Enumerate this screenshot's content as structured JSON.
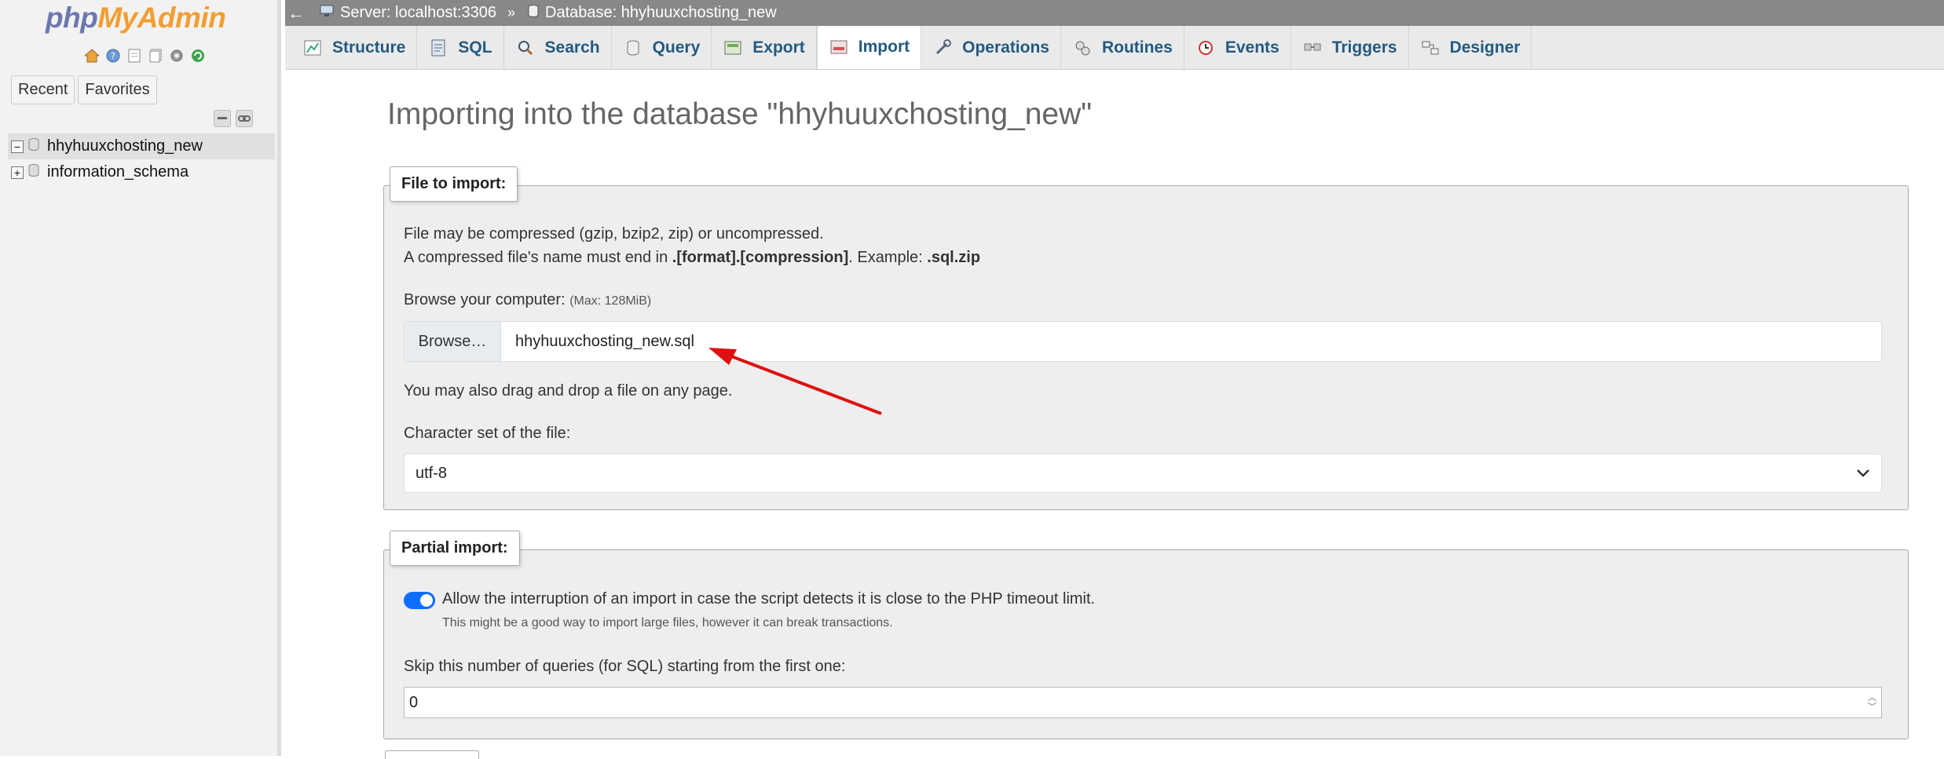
{
  "sidebar": {
    "logo_php": "php",
    "logo_myadmin": "MyAdmin",
    "tabs": {
      "recent": "Recent",
      "favorites": "Favorites"
    },
    "databases": [
      {
        "name": "hhyhuuxchosting_new",
        "expander": "−"
      },
      {
        "name": "information_schema",
        "expander": "+"
      }
    ]
  },
  "breadcrumb": {
    "back": "←",
    "server": "Server: localhost:3306",
    "separator": "»",
    "database": "Database: hhyhuuxchosting_new"
  },
  "tabs": [
    {
      "label": "Structure",
      "icon": "structure-icon"
    },
    {
      "label": "SQL",
      "icon": "sql-icon"
    },
    {
      "label": "Search",
      "icon": "search-icon"
    },
    {
      "label": "Query",
      "icon": "query-icon"
    },
    {
      "label": "Export",
      "icon": "export-icon"
    },
    {
      "label": "Import",
      "icon": "import-icon",
      "active": true
    },
    {
      "label": "Operations",
      "icon": "operations-icon"
    },
    {
      "label": "Routines",
      "icon": "routines-icon"
    },
    {
      "label": "Events",
      "icon": "events-icon"
    },
    {
      "label": "Triggers",
      "icon": "triggers-icon"
    },
    {
      "label": "Designer",
      "icon": "designer-icon"
    }
  ],
  "page": {
    "heading": "Importing into the database \"hhyhuuxchosting_new\""
  },
  "file_import": {
    "legend": "File to import:",
    "line1": "File may be compressed (gzip, bzip2, zip) or uncompressed.",
    "line2_prefix": "A compressed file's name must end in ",
    "line2_format": ".[format].[compression]",
    "line2_middle": ". Example: ",
    "line2_example": ".sql.zip",
    "browse_label": "Browse your computer:",
    "max_size": "(Max: 128MiB)",
    "browse_button": "Browse…",
    "file_name": "hhyhuuxchosting_new.sql",
    "drag_drop": "You may also drag and drop a file on any page.",
    "charset_label": "Character set of the file:",
    "charset_value": "utf-8"
  },
  "partial_import": {
    "legend": "Partial import:",
    "allow_interrupt_label": "Allow the interruption of an import in case the script detects it is close to the PHP timeout limit.",
    "allow_interrupt_checked": true,
    "allow_interrupt_hint": "This might be a good way to import large files, however it can break transactions.",
    "skip_label": "Skip this number of queries (for SQL) starting from the first one:",
    "skip_value": "0"
  },
  "colors": {
    "link": "#235a81",
    "breadcrumb_bg": "#888888",
    "toggle_on": "#0d6efd",
    "annotation_arrow": "#dd1111"
  }
}
